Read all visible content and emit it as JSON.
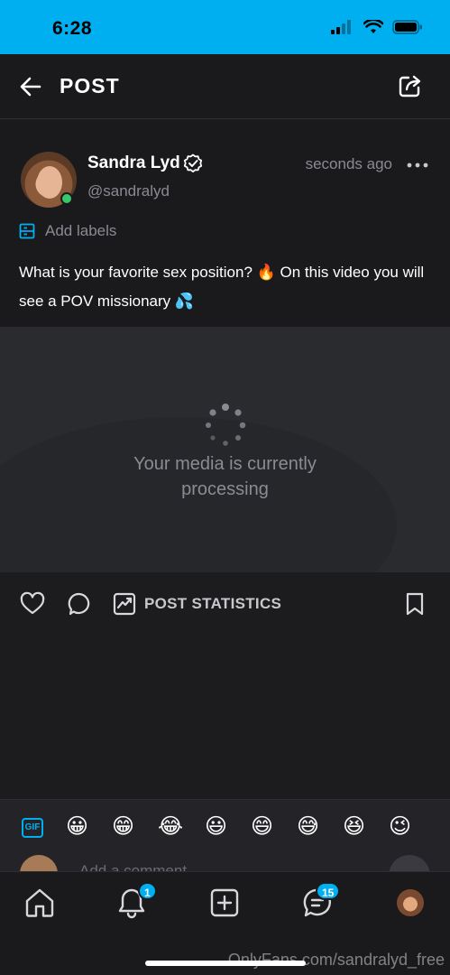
{
  "status_bar": {
    "time": "6:28"
  },
  "header": {
    "title": "POST"
  },
  "post": {
    "author_name": "Sandra Lyd",
    "author_handle": "@sandralyd",
    "time_ago": "seconds ago",
    "labels_text": "Add labels",
    "text": "What is your favorite sex position? 🔥 On this video you will see a POV missionary 💦",
    "media_status_line1": "Your media is currently",
    "media_status_line2": "processing"
  },
  "actions": {
    "stats_label": "POST STATISTICS"
  },
  "emoji_bar": {
    "gif_label": "GIF",
    "emojis": [
      "😀",
      "😁",
      "😂",
      "😃",
      "😄",
      "😅",
      "😆",
      "😉"
    ]
  },
  "comment": {
    "placeholder": "Add a comment..."
  },
  "tab_bar": {
    "notifications_badge": "1",
    "messages_badge": "15"
  },
  "watermark": "OnlyFans.com/sandralyd_free",
  "colors": {
    "accent": "#00aff0",
    "online": "#3ac66a",
    "background": "#1c1c1f"
  },
  "icons": [
    "back-arrow-icon",
    "share-icon",
    "verified-icon",
    "more-icon",
    "labels-icon",
    "heart-icon",
    "comment-icon",
    "stats-icon",
    "bookmark-icon",
    "home-icon",
    "bell-icon",
    "add-icon",
    "messages-icon",
    "send-icon"
  ]
}
